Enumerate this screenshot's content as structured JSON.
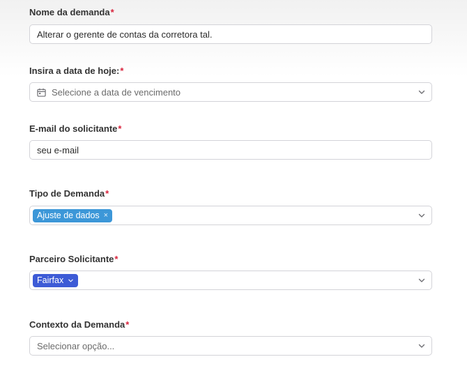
{
  "fields": {
    "nome": {
      "label": "Nome da demanda",
      "required_mark": "*",
      "value": "Alterar o gerente de contas da corretora tal."
    },
    "data": {
      "label": "Insira a data de hoje:",
      "required_mark": "*",
      "placeholder": "Selecione a data de vencimento",
      "icon": "calendar-icon"
    },
    "email": {
      "label": "E-mail do solicitante",
      "required_mark": "*",
      "value": "seu e-mail"
    },
    "tipo": {
      "label": "Tipo de Demanda",
      "required_mark": "*",
      "selected_tag": "Ajuste de dados",
      "tag_remove": "×",
      "tag_color": "#3c97d8"
    },
    "parceiro": {
      "label": "Parceiro Solicitante",
      "required_mark": "*",
      "selected_tag": "Fairfax",
      "tag_color": "#3d5bd6"
    },
    "contexto": {
      "label": "Contexto da Demanda",
      "required_mark": "*",
      "placeholder": "Selecionar opção..."
    }
  },
  "colors": {
    "required": "#d9243d",
    "border": "#d3d3d8",
    "chevron": "#6e6e73"
  }
}
